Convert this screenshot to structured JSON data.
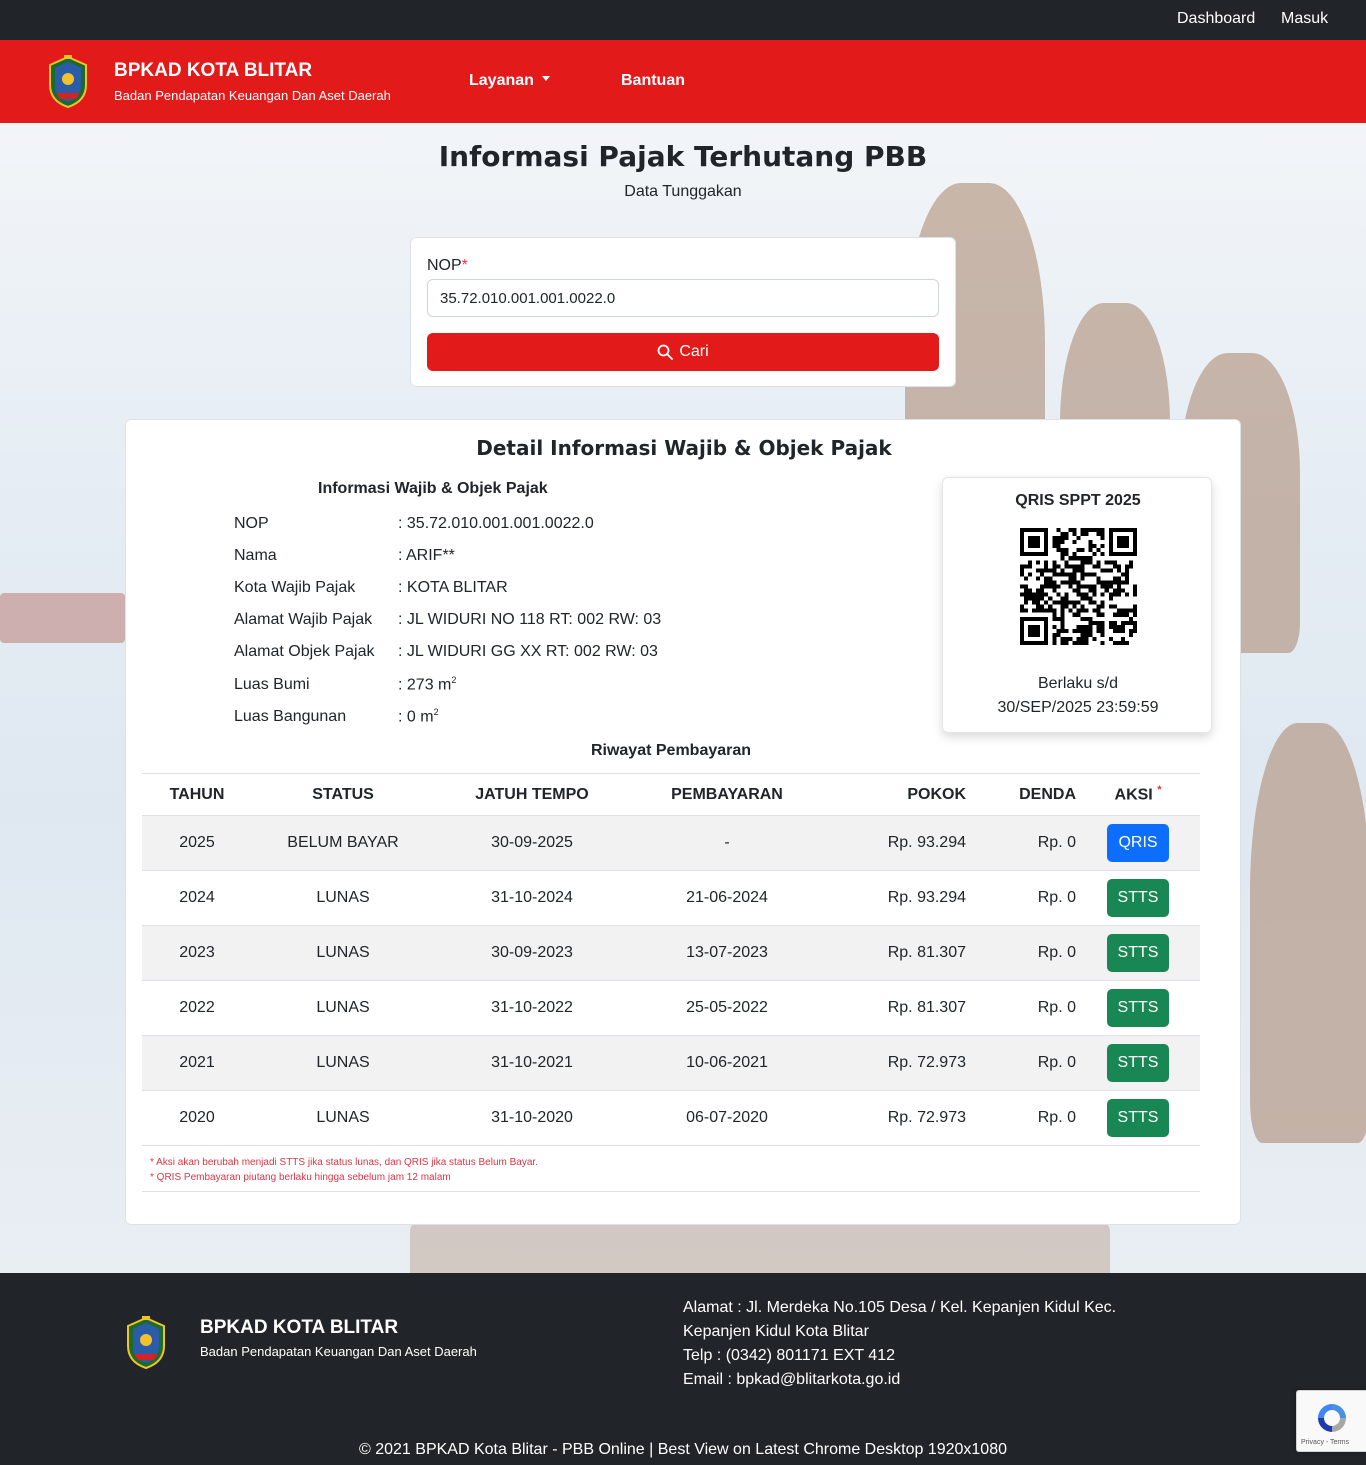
{
  "topbar": {
    "dashboard": "Dashboard",
    "login": "Masuk"
  },
  "header": {
    "title": "BPKAD KOTA BLITAR",
    "subtitle": "Badan Pendapatan Keuangan Dan Aset Daerah",
    "nav": {
      "layanan": "Layanan",
      "bantuan": "Bantuan"
    }
  },
  "page": {
    "title": "Informasi Pajak Terhutang PBB",
    "subtitle": "Data Tunggakan"
  },
  "search": {
    "label": "NOP",
    "required_mark": "*",
    "value": "35.72.010.001.001.0022.0",
    "button": "Cari"
  },
  "detail": {
    "title": "Detail Informasi Wajib & Objek Pajak",
    "info_heading": "Informasi Wajib & Objek Pajak",
    "rows": [
      {
        "key": "NOP",
        "value": ": 35.72.010.001.001.0022.0"
      },
      {
        "key": "Nama",
        "value": ": ARIF**"
      },
      {
        "key": "Kota Wajib Pajak",
        "value": ": KOTA BLITAR"
      },
      {
        "key": "Alamat Wajib Pajak",
        "value": ": JL WIDURI NO 118 RT: 002 RW: 03"
      },
      {
        "key": "Alamat Objek Pajak",
        "value": ": JL WIDURI GG XX RT: 002 RW: 03"
      },
      {
        "key": "Luas Bumi",
        "value": ": 273 m",
        "sup": "2"
      },
      {
        "key": "Luas Bangunan",
        "value": ": 0 m",
        "sup": "2"
      }
    ],
    "qris": {
      "title": "QRIS SPPT 2025",
      "valid_label": "Berlaku s/d",
      "valid_until": "30/SEP/2025 23:59:59"
    },
    "history_title": "Riwayat Pembayaran",
    "columns": [
      "TAHUN",
      "STATUS",
      "JATUH TEMPO",
      "PEMBAYARAN",
      "POKOK",
      "DENDA",
      "AKSI"
    ],
    "aksi_mark": "*",
    "history": [
      {
        "tahun": "2025",
        "status": "BELUM BAYAR",
        "jatuh_tempo": "30-09-2025",
        "pembayaran": "-",
        "pokok": "Rp. 93.294",
        "denda": "Rp. 0",
        "aksi": "QRIS"
      },
      {
        "tahun": "2024",
        "status": "LUNAS",
        "jatuh_tempo": "31-10-2024",
        "pembayaran": "21-06-2024",
        "pokok": "Rp. 93.294",
        "denda": "Rp. 0",
        "aksi": "STTS"
      },
      {
        "tahun": "2023",
        "status": "LUNAS",
        "jatuh_tempo": "30-09-2023",
        "pembayaran": "13-07-2023",
        "pokok": "Rp. 81.307",
        "denda": "Rp. 0",
        "aksi": "STTS"
      },
      {
        "tahun": "2022",
        "status": "LUNAS",
        "jatuh_tempo": "31-10-2022",
        "pembayaran": "25-05-2022",
        "pokok": "Rp. 81.307",
        "denda": "Rp. 0",
        "aksi": "STTS"
      },
      {
        "tahun": "2021",
        "status": "LUNAS",
        "jatuh_tempo": "31-10-2021",
        "pembayaran": "10-06-2021",
        "pokok": "Rp. 72.973",
        "denda": "Rp. 0",
        "aksi": "STTS"
      },
      {
        "tahun": "2020",
        "status": "LUNAS",
        "jatuh_tempo": "31-10-2020",
        "pembayaran": "06-07-2020",
        "pokok": "Rp. 72.973",
        "denda": "Rp. 0",
        "aksi": "STTS"
      }
    ],
    "notes": [
      "* Aksi akan berubah menjadi STTS jika status lunas, dan QRIS jika status Belum Bayar.",
      "* QRIS Pembayaran piutang berlaku hingga sebelum jam 12 malam"
    ]
  },
  "footer": {
    "title": "BPKAD KOTA BLITAR",
    "subtitle": "Badan Pendapatan Keuangan Dan Aset Daerah",
    "address": "Alamat : Jl. Merdeka No.105 Desa / Kel. Kepanjen Kidul Kec. Kepanjen Kidul Kota Blitar",
    "phone": "Telp : (0342) 801171 EXT 412",
    "email": "Email : bpkad@blitarkota.go.id",
    "copyright": "© 2021 BPKAD Kota Blitar - PBB Online | Best View on Latest Chrome Desktop 1920x1080"
  },
  "recaptcha": {
    "links": "Privacy - Terms"
  },
  "colors": {
    "brand_red": "#e21a1a",
    "dark": "#212529",
    "qris_blue": "#0d6efd",
    "stts_green": "#198754",
    "note_red": "#dc3545"
  },
  "icons": {
    "search": "search-icon",
    "logo": "city-emblem-icon",
    "dropdown": "chevron-down-icon",
    "recaptcha": "recaptcha-icon"
  }
}
